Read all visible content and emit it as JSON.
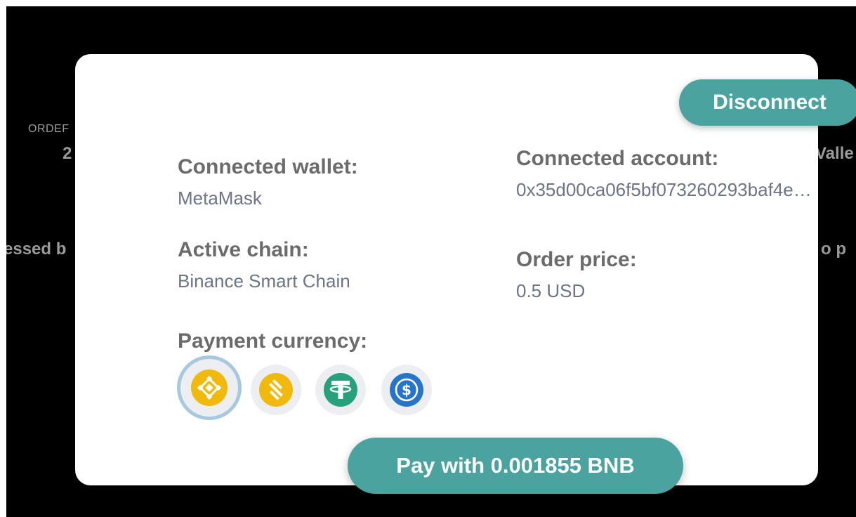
{
  "background": {
    "order_label": "ORDEF",
    "order_value": "2",
    "wallet_fragment": "Valle",
    "processed_fragment": "essed b",
    "right_fragment": "o p"
  },
  "modal": {
    "disconnect_label": "Disconnect",
    "connected_wallet_label": "Connected wallet:",
    "connected_wallet_value": "MetaMask",
    "connected_account_label": "Connected account:",
    "connected_account_value": "0x35d00ca06f5bf073260293baf4e…",
    "active_chain_label": "Active chain:",
    "active_chain_value": "Binance Smart Chain",
    "order_price_label": "Order price:",
    "order_price_value": "0.5 USD",
    "payment_currency_label": "Payment currency:",
    "currencies": [
      {
        "icon": "bnb-coin-icon",
        "selected": true
      },
      {
        "icon": "busd-coin-icon",
        "selected": false
      },
      {
        "icon": "usdt-coin-icon",
        "selected": false
      },
      {
        "icon": "usdc-coin-icon",
        "selected": false
      }
    ],
    "pay_label": "Pay with 0.001855 BNB"
  },
  "colors": {
    "accent": "#4aa39e",
    "label": "#6b6b6b",
    "value": "#6d7488",
    "selected_ring": "#a7c9e0",
    "bnb": "#f0b90b",
    "usdt": "#26a17b",
    "usdc": "#2775ca"
  }
}
